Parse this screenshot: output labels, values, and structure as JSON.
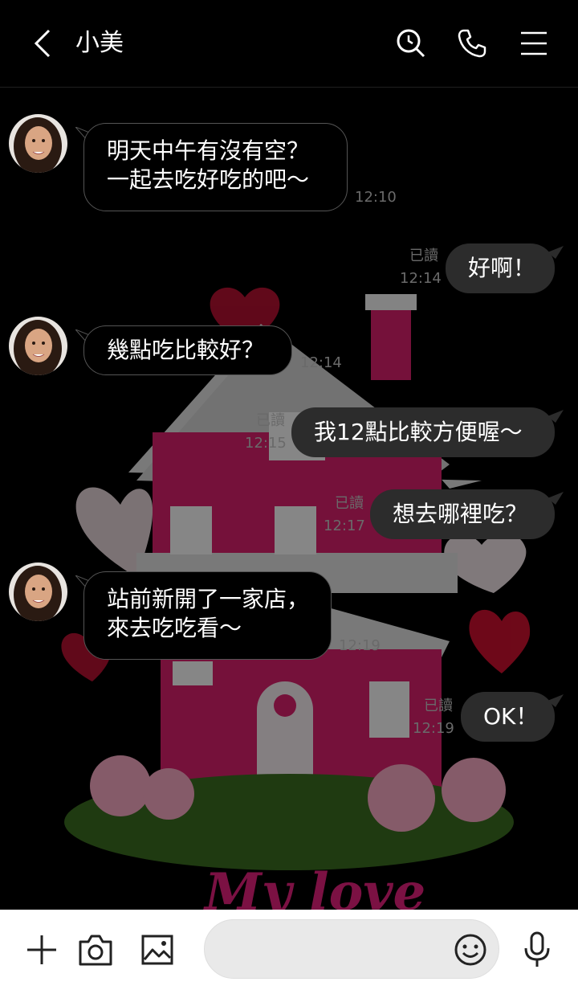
{
  "header": {
    "title": "小美"
  },
  "messages": [
    {
      "text": "明天中午有沒有空？\n一起去吃好吃的吧～",
      "time": "12:10"
    },
    {
      "text": "好啊！",
      "time": "12:14",
      "read": "已讀"
    },
    {
      "text": "幾點吃比較好？",
      "time": "12:14"
    },
    {
      "text": "我12點比較方便喔～",
      "time": "12:15",
      "read": "已讀"
    },
    {
      "text": "想去哪裡吃？",
      "time": "12:17",
      "read": "已讀"
    },
    {
      "text": "站前新開了一家店，\n來去吃吃看～",
      "time": "12:19"
    },
    {
      "text": "OK！",
      "time": "12:19",
      "read": "已讀"
    }
  ],
  "background": {
    "caption": "My love"
  },
  "composer": {
    "placeholder": ""
  },
  "colors": {
    "background": "#000000",
    "incoming_bubble": "#000000",
    "outgoing_bubble": "#2c2c2c",
    "bottom_bar": "#ffffff"
  },
  "icons": [
    "back-icon",
    "search-icon",
    "phone-icon",
    "menu-icon",
    "plus-icon",
    "camera-icon",
    "image-icon",
    "emoji-icon",
    "mic-icon"
  ]
}
